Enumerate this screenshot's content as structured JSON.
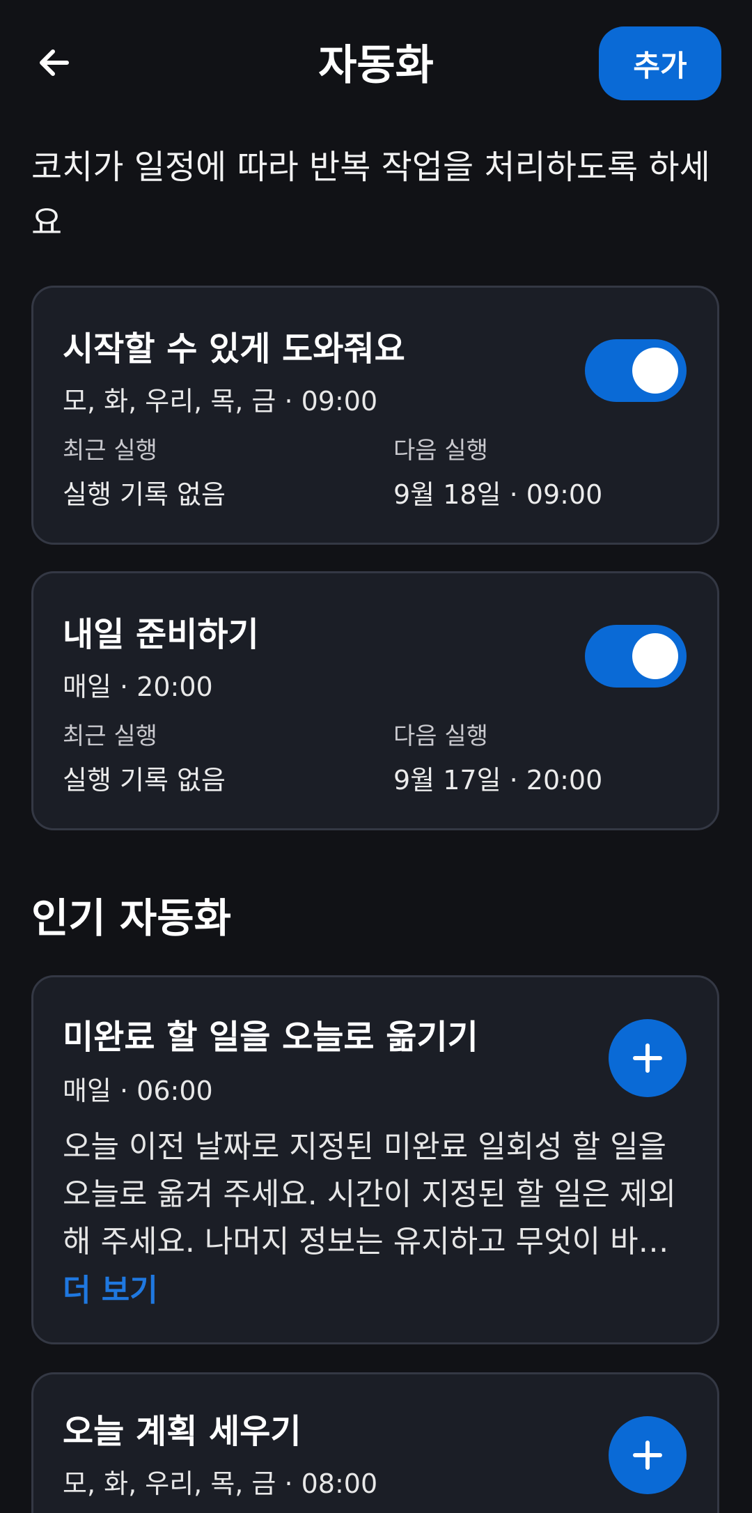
{
  "header": {
    "title": "자동화",
    "add_label": "추가"
  },
  "subtitle": "코치가 일정에 따라 반복 작업을 처리하도록 하세요",
  "automations": [
    {
      "title": "시작할 수 있게 도와줘요",
      "schedule": "모, 화, 우리, 목, 금 · 09:00",
      "enabled": true,
      "last_run_label": "최근 실행",
      "last_run_value": "실행 기록 없음",
      "next_run_label": "다음 실행",
      "next_run_value": "9월 18일 · 09:00"
    },
    {
      "title": "내일 준비하기",
      "schedule": "매일 · 20:00",
      "enabled": true,
      "last_run_label": "최근 실행",
      "last_run_value": "실행 기록 없음",
      "next_run_label": "다음 실행",
      "next_run_value": "9월 17일 · 20:00"
    }
  ],
  "popular": {
    "section_title": "인기 자동화",
    "items": [
      {
        "title": "미완료 할 일을 오늘로 옮기기",
        "schedule": "매일 · 06:00",
        "description": "오늘 이전 날짜로 지정된 미완료 일회성 할 일을 오늘로 옮겨 주세요. 시간이 지정된 할 일은 제외해 주세요. 나머지 정보는 유지하고 무엇이 바…",
        "more_label": "더 보기"
      },
      {
        "title": "오늘 계획 세우기",
        "schedule": "모, 화, 우리, 목, 금 · 08:00"
      }
    ]
  },
  "colors": {
    "background": "#111216",
    "card": "#1b1e26",
    "accent": "#0a6ad6",
    "link": "#1f78e0"
  },
  "icons": {
    "back": "arrow-left-icon",
    "plus": "plus-icon"
  }
}
